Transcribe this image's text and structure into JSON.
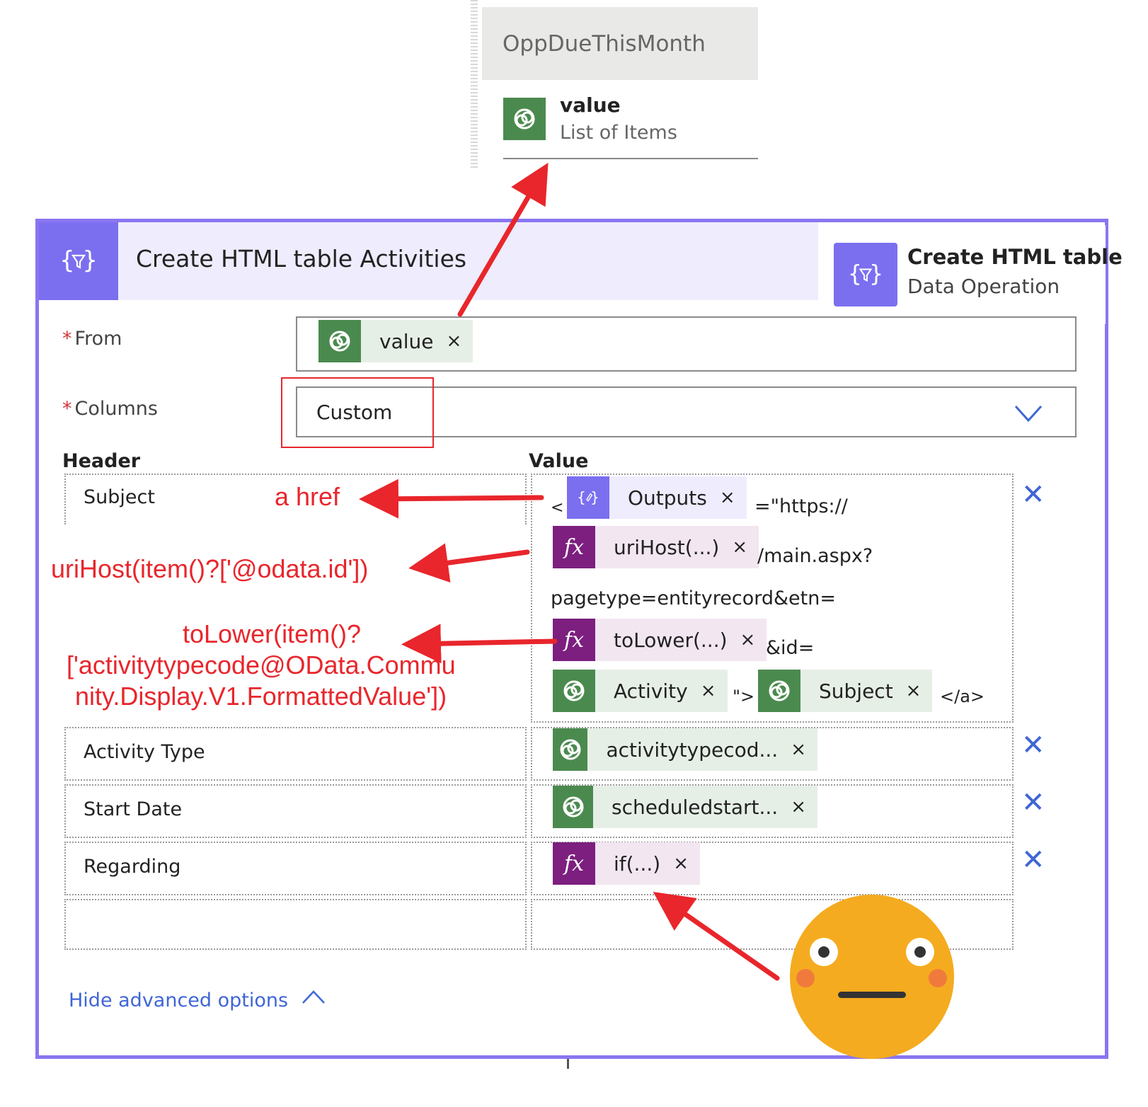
{
  "dynamic_content": {
    "section_title": "OppDueThisMonth",
    "item_title": "value",
    "item_subtitle": "List of Items"
  },
  "card": {
    "title": "Create HTML table Activities",
    "tooltip_title": "Create HTML table",
    "tooltip_subtitle": "Data Operation",
    "from_label": "From",
    "from_token": "value",
    "columns_label": "Columns",
    "columns_value": "Custom",
    "header_col": "Header",
    "value_col": "Value",
    "rows": [
      {
        "header": "Subject"
      },
      {
        "header": "Activity Type",
        "token": "activitytypecod..."
      },
      {
        "header": "Start Date",
        "token": "scheduledstart..."
      },
      {
        "header": "Regarding",
        "token": "if(...)"
      }
    ],
    "subject_value": {
      "lt": "<",
      "outputs": "Outputs",
      "eq_https": "=\"https://",
      "urihost": "uriHost(...)",
      "main_aspx": "/main.aspx?",
      "pagetype": "pagetype=entityrecord&etn=",
      "tolower": "toLower(...)",
      "amp_id": "&id=",
      "activity": "Activity",
      "quote_gt": "\">",
      "subject": "Subject",
      "close_a": "</a>"
    },
    "hide_advanced": "Hide advanced options",
    "remove_glyph": "✕",
    "close_glyph": "×",
    "fx_glyph": "fx"
  },
  "annotations": {
    "a_href": "a href",
    "urihost": "uriHost(item()?['@odata.id'])",
    "tolower_1": "toLower(item()?",
    "tolower_2": "['activitytypecode@OData.Commu",
    "tolower_3": "nity.Display.V1.FormattedValue'])"
  },
  "colors": {
    "accent": "#7b6ff0",
    "dataverse": "#4b8a4e",
    "expression": "#7c1f7f",
    "annotation": "#e8262c",
    "link": "#3f66d6"
  }
}
